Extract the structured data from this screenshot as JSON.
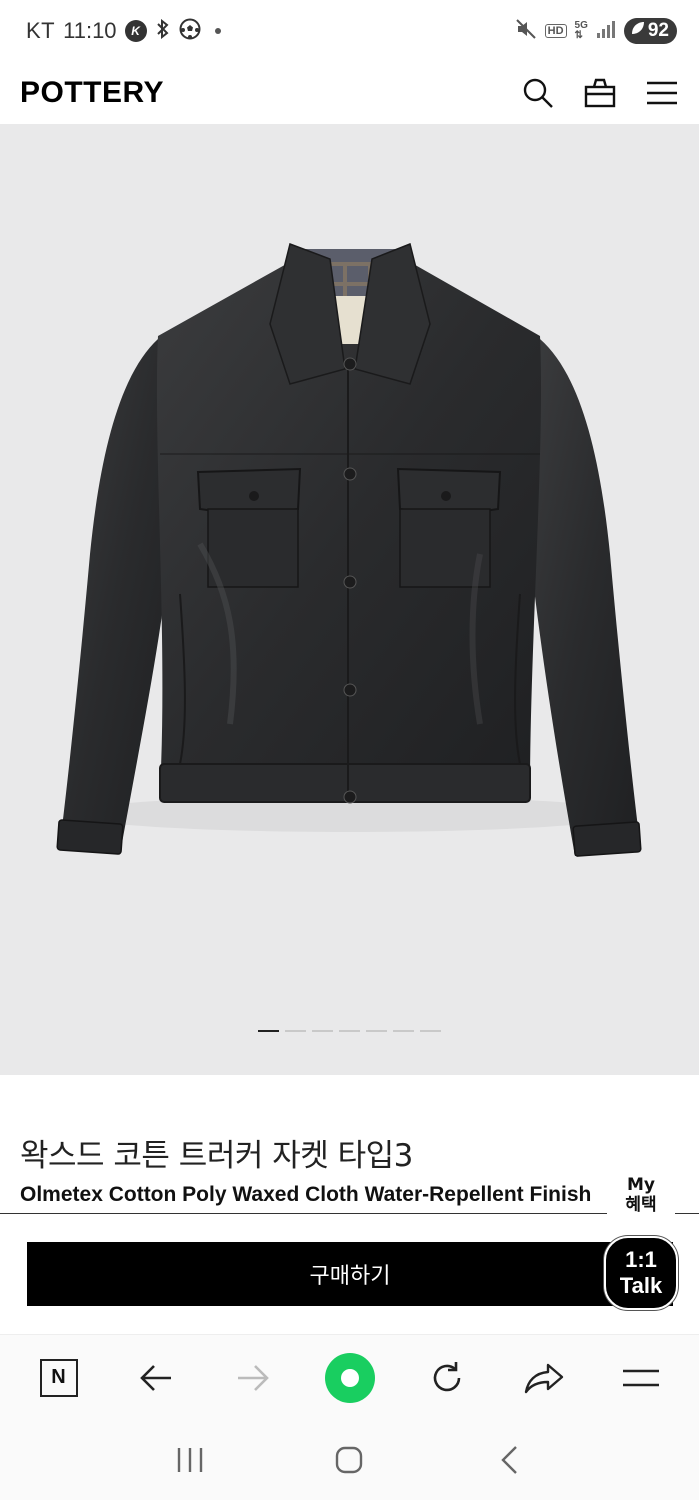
{
  "status_bar": {
    "carrier": "KT",
    "time": "11:10",
    "battery": "92",
    "hd_label": "HD",
    "network_label": "5G"
  },
  "header": {
    "logo": "POTTERY"
  },
  "hero": {
    "background_color": "#e9e9ea",
    "slide_count": 7,
    "active_slide": 1
  },
  "product": {
    "title": "왁스드 코튼 트러커 자켓 타입3",
    "subtitle": "Olmetex Cotton Poly Waxed Cloth Water-Repellent Finish"
  },
  "floating": {
    "my_benefit_line1": "My",
    "my_benefit_line2": "혜택",
    "talk_line1": "1:1",
    "talk_line2": "Talk"
  },
  "cta": {
    "buy_label": "구매하기"
  },
  "browser_toolbar": {
    "home_label": "N",
    "accent_color": "#19ce60"
  }
}
